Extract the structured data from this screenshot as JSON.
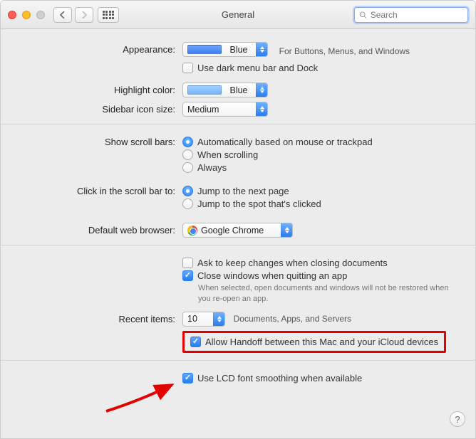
{
  "title": "General",
  "search": {
    "placeholder": "Search"
  },
  "sections": {
    "appearance": {
      "label": "Appearance:",
      "value": "Blue",
      "note": "For Buttons, Menus, and Windows",
      "dark_menu": {
        "label": "Use dark menu bar and Dock",
        "checked": false
      }
    },
    "highlight": {
      "label": "Highlight color:",
      "value": "Blue"
    },
    "sidebar": {
      "label": "Sidebar icon size:",
      "value": "Medium"
    },
    "scrollbars": {
      "label": "Show scroll bars:",
      "options": [
        {
          "label": "Automatically based on mouse or trackpad",
          "checked": true
        },
        {
          "label": "When scrolling",
          "checked": false
        },
        {
          "label": "Always",
          "checked": false
        }
      ]
    },
    "clickbar": {
      "label": "Click in the scroll bar to:",
      "options": [
        {
          "label": "Jump to the next page",
          "checked": true
        },
        {
          "label": "Jump to the spot that's clicked",
          "checked": false
        }
      ]
    },
    "browser": {
      "label": "Default web browser:",
      "value": "Google Chrome"
    },
    "docs": {
      "ask": {
        "label": "Ask to keep changes when closing documents",
        "checked": false
      },
      "close": {
        "label": "Close windows when quitting an app",
        "checked": true,
        "hint": "When selected, open documents and windows will not be restored when you re-open an app."
      }
    },
    "recent": {
      "label": "Recent items:",
      "value": "10",
      "suffix": "Documents, Apps, and Servers"
    },
    "handoff": {
      "label": "Allow Handoff between this Mac and your iCloud devices",
      "checked": true
    },
    "lcd": {
      "label": "Use LCD font smoothing when available",
      "checked": true
    }
  }
}
